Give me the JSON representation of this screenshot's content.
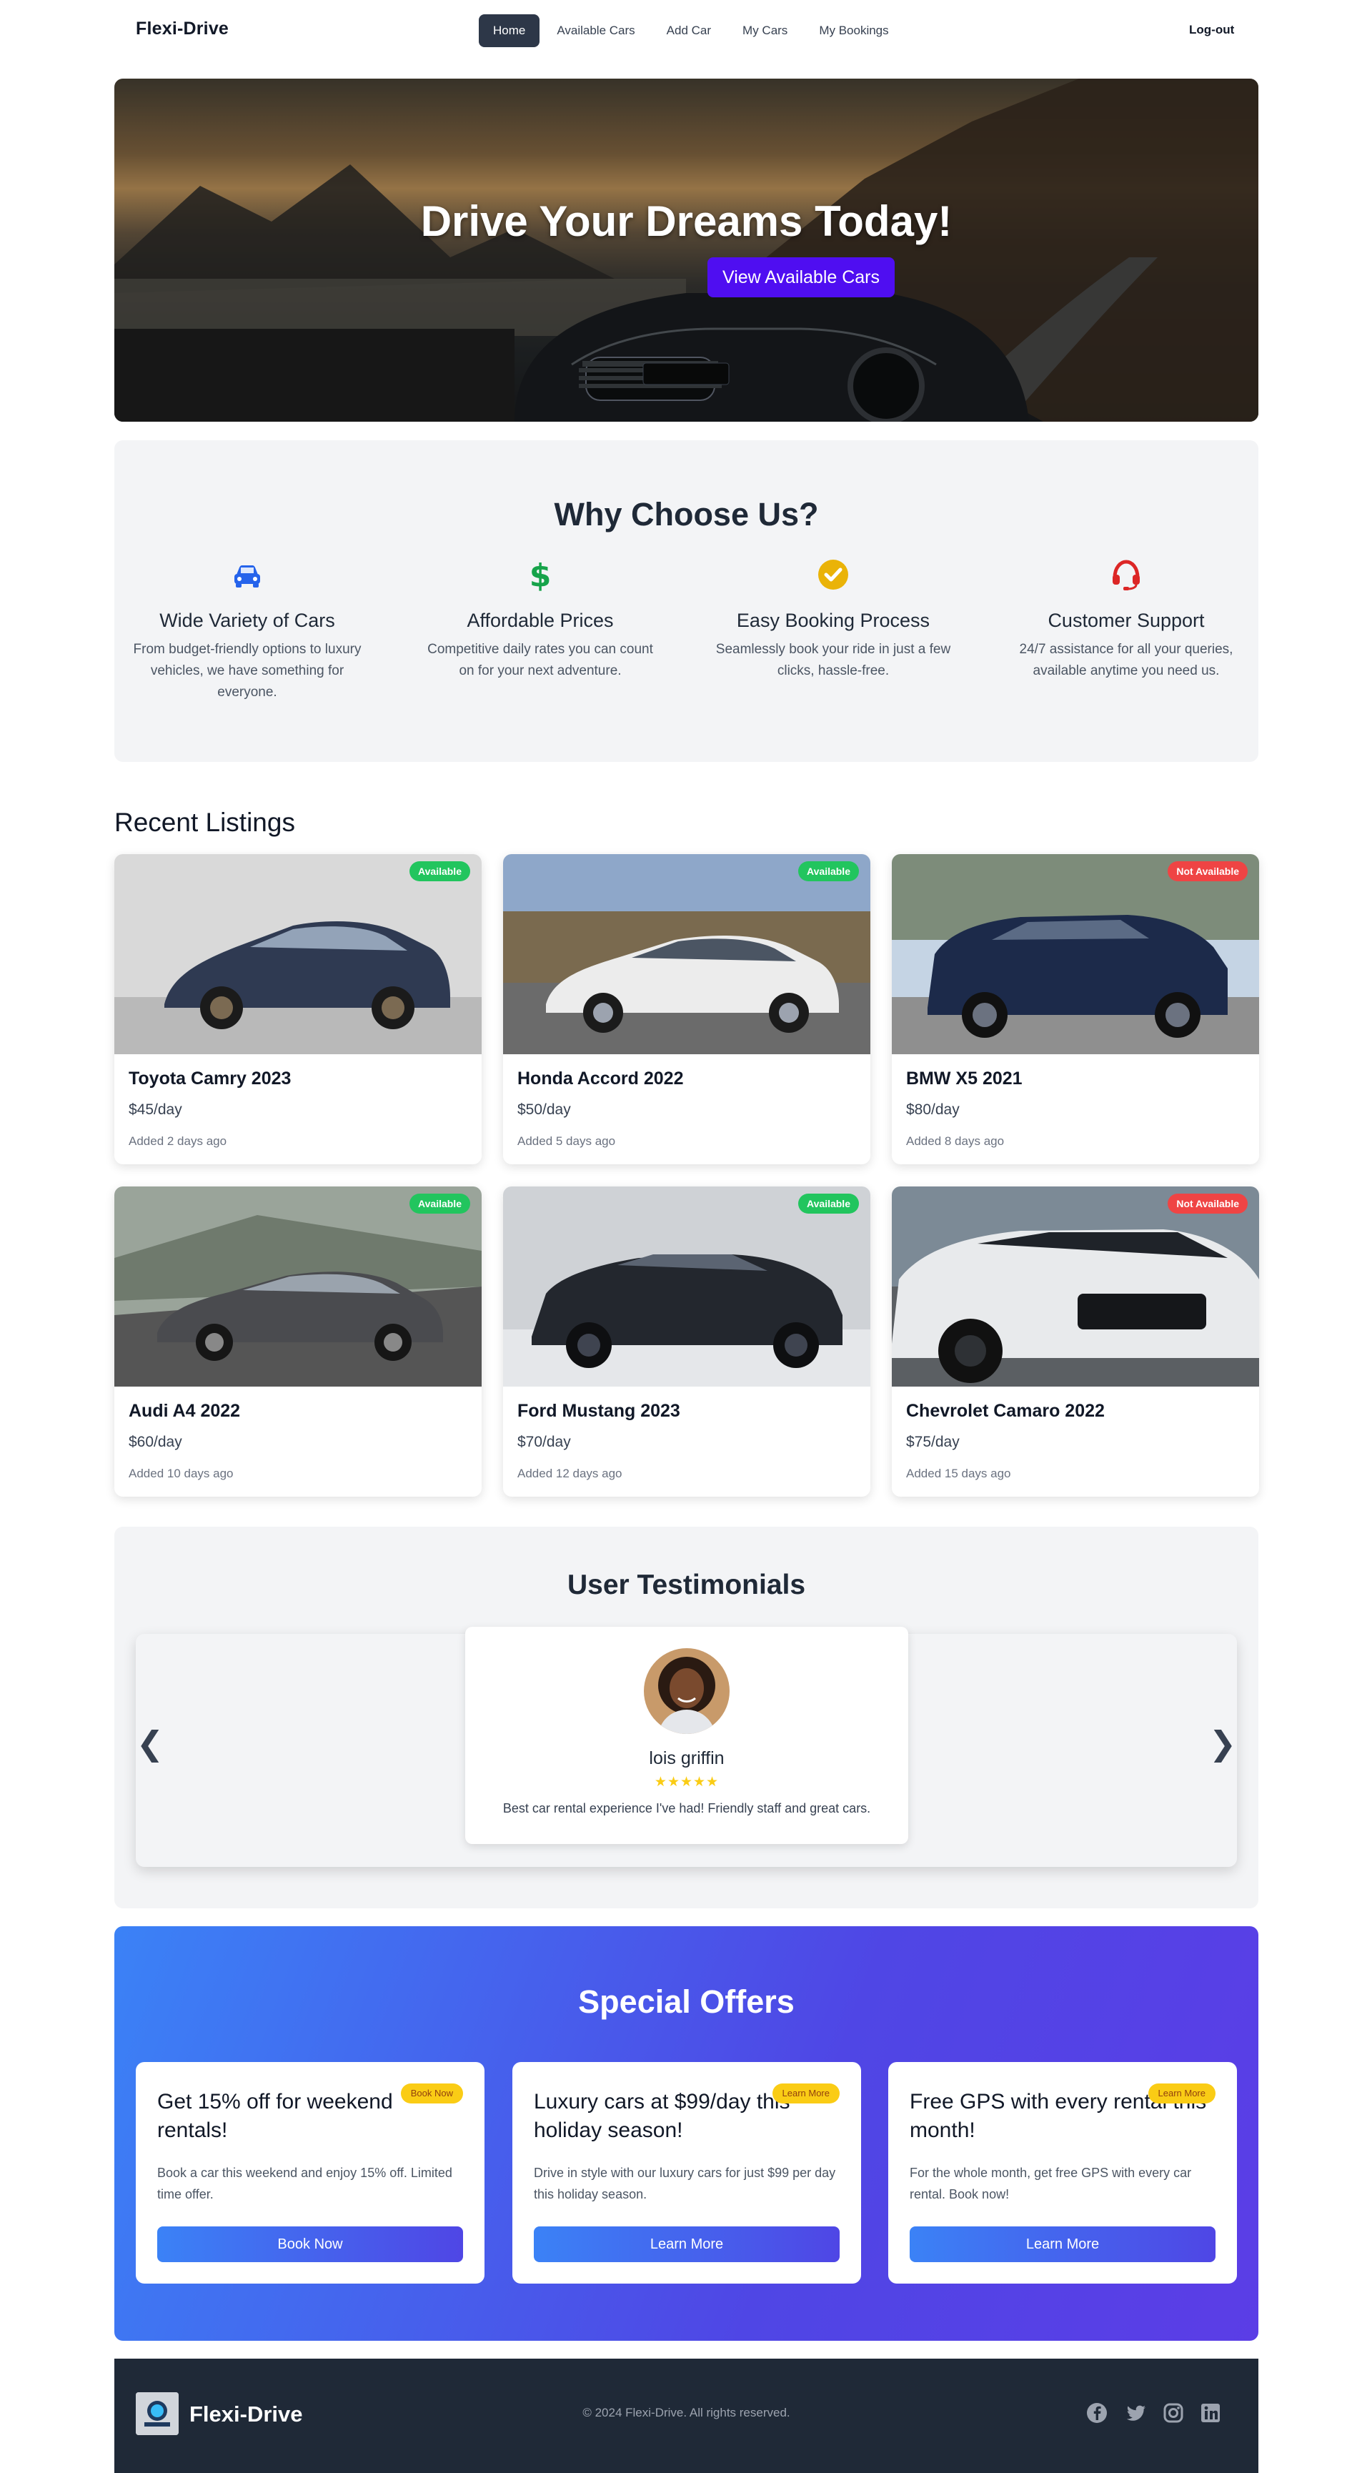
{
  "nav": {
    "brand": "Flexi-Drive",
    "links": [
      "Home",
      "Available Cars",
      "Add Car",
      "My Cars",
      "My Bookings"
    ],
    "active": "Home",
    "logout": "Log-out"
  },
  "hero": {
    "title": "Drive Your Dreams Today!",
    "button": "View Available Cars"
  },
  "why": {
    "title": "Why Choose Us?",
    "features": [
      {
        "icon": "car-icon",
        "color": "#2563eb",
        "title": "Wide Variety of Cars",
        "desc": "From budget-friendly options to luxury vehicles, we have something for everyone."
      },
      {
        "icon": "dollar-icon",
        "color": "#16a34a",
        "title": "Affordable Prices",
        "desc": "Competitive daily rates you can count on for your next adventure."
      },
      {
        "icon": "check-circle-icon",
        "color": "#eab308",
        "title": "Easy Booking Process",
        "desc": "Seamlessly book your ride in just a few clicks, hassle-free."
      },
      {
        "icon": "headset-icon",
        "color": "#dc2626",
        "title": "Customer Support",
        "desc": "24/7 assistance for all your queries, available anytime you need us."
      }
    ]
  },
  "recent": {
    "title": "Recent Listings",
    "cars": [
      {
        "name": "Toyota Camry 2023",
        "price": "$45/day",
        "added": "Added 2 days ago",
        "status": "Available"
      },
      {
        "name": "Honda Accord 2022",
        "price": "$50/day",
        "added": "Added 5 days ago",
        "status": "Available"
      },
      {
        "name": "BMW X5 2021",
        "price": "$80/day",
        "added": "Added 8 days ago",
        "status": "Not Available"
      },
      {
        "name": "Audi A4 2022",
        "price": "$60/day",
        "added": "Added 10 days ago",
        "status": "Available"
      },
      {
        "name": "Ford Mustang 2023",
        "price": "$70/day",
        "added": "Added 12 days ago",
        "status": "Available"
      },
      {
        "name": "Chevrolet Camaro 2022",
        "price": "$75/day",
        "added": "Added 15 days ago",
        "status": "Not Available"
      }
    ]
  },
  "testimonials": {
    "title": "User Testimonials",
    "prev": "❮",
    "next": "❯",
    "current": {
      "name": "lois griffin",
      "rating": 5,
      "stars": "★★★★★",
      "quote": "Best car rental experience I've had! Friendly staff and great cars."
    }
  },
  "offers": {
    "title": "Special Offers",
    "items": [
      {
        "title": "Get 15% off for weekend rentals!",
        "tag": "Book Now",
        "desc": "Book a car this weekend and enjoy 15% off. Limited time offer.",
        "button": "Book Now"
      },
      {
        "title": "Luxury cars at $99/day this holiday season!",
        "tag": "Learn More",
        "desc": "Drive in style with our luxury cars for just $99 per day this holiday season.",
        "button": "Learn More"
      },
      {
        "title": "Free GPS with every rental this month!",
        "tag": "Learn More",
        "desc": "For the whole month, get free GPS with every car rental. Book now!",
        "button": "Learn More"
      }
    ]
  },
  "footer": {
    "brand": "Flexi-Drive",
    "copyright": "© 2024 Flexi-Drive. All rights reserved.",
    "social": [
      "facebook-icon",
      "twitter-icon",
      "instagram-icon",
      "linkedin-icon"
    ]
  }
}
